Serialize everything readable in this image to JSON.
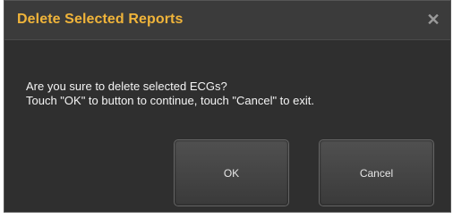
{
  "dialog": {
    "title": "Delete Selected Reports",
    "close_icon": "close-icon",
    "message_line1": "Are you sure to delete selected ECGs?",
    "message_line2": "Touch \"OK\" to button to continue, touch \"Cancel\" to exit.",
    "ok_label": "OK",
    "cancel_label": "Cancel"
  },
  "colors": {
    "title": "#f0b43a",
    "background": "#2f2f2f",
    "text": "#f4f4f4"
  }
}
